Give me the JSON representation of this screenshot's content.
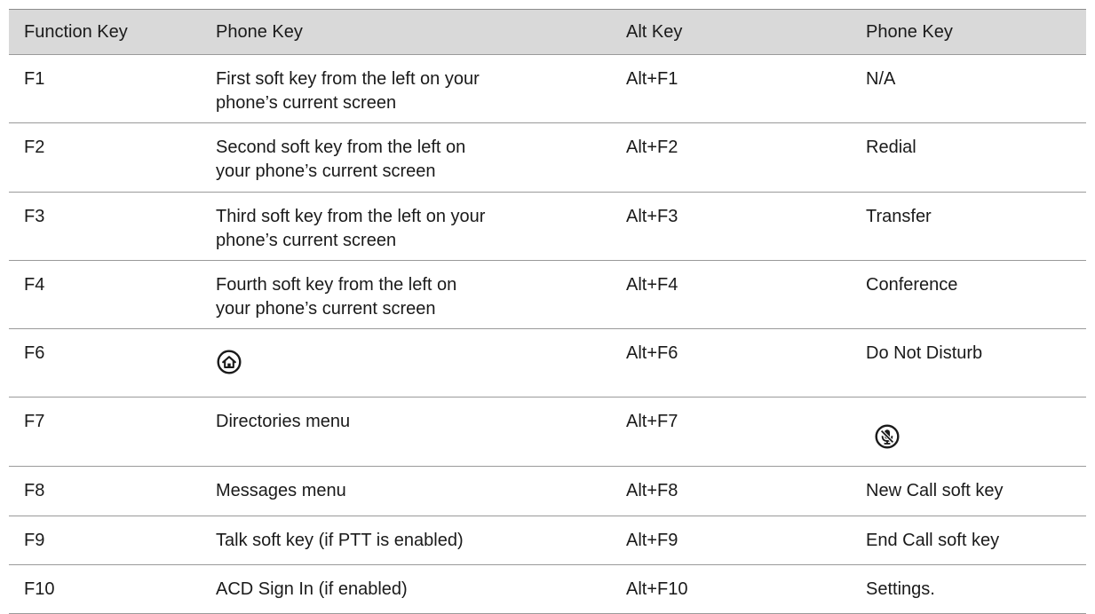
{
  "table": {
    "headers": [
      "Function Key",
      "Phone Key",
      "Alt Key",
      "Phone Key"
    ],
    "rows": [
      {
        "fn": "F1",
        "phone": [
          "First soft key from the left on your",
          "phone’s current screen"
        ],
        "alt": "Alt+F1",
        "alt_phone": "N/A"
      },
      {
        "fn": "F2",
        "phone": [
          "Second soft key from the left on",
          "your phone’s current screen"
        ],
        "alt": "Alt+F2",
        "alt_phone": "Redial"
      },
      {
        "fn": "F3",
        "phone": [
          "Third soft key from the left on your",
          "phone’s current screen"
        ],
        "alt": "Alt+F3",
        "alt_phone": "Transfer"
      },
      {
        "fn": "F4",
        "phone": [
          "Fourth soft key from the left on",
          "your phone’s current screen"
        ],
        "alt": "Alt+F4",
        "alt_phone": "Conference"
      },
      {
        "fn": "F6",
        "phone_icon": "home-icon",
        "alt": "Alt+F6",
        "alt_phone": "Do Not Disturb"
      },
      {
        "fn": "F7",
        "phone": [
          "Directories menu"
        ],
        "alt": "Alt+F7",
        "alt_phone_icon": "mute-microphone-icon"
      },
      {
        "fn": "F8",
        "phone": [
          "Messages menu"
        ],
        "alt": "Alt+F8",
        "alt_phone": "New Call soft key"
      },
      {
        "fn": "F9",
        "phone": [
          "Talk soft key (if PTT is enabled)"
        ],
        "alt": "Alt+F9",
        "alt_phone": "End Call soft key"
      },
      {
        "fn": "F10",
        "phone": [
          "ACD Sign In (if enabled)"
        ],
        "alt": "Alt+F10",
        "alt_phone": "Settings."
      }
    ]
  }
}
